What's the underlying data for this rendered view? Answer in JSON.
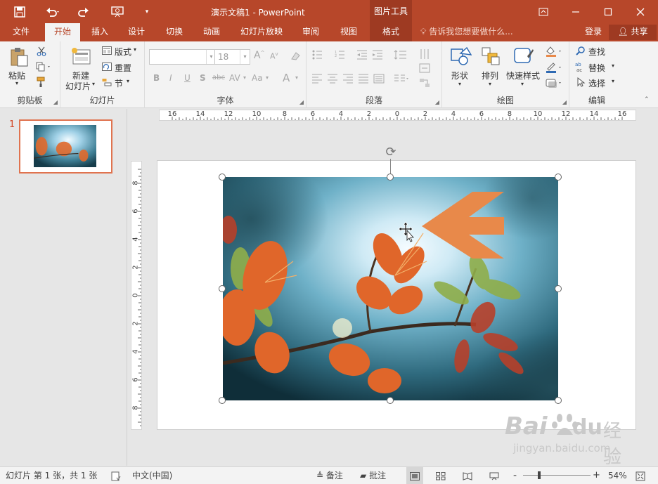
{
  "titlebar": {
    "title": "演示文稿1 - PowerPoint",
    "context_group": "图片工具",
    "qat": {
      "save_icon": "save-icon",
      "undo_icon": "undo-icon",
      "redo_icon": "redo-icon",
      "start_icon": "presentation-start-icon",
      "customize_icon": "customize-icon"
    }
  },
  "tabs": {
    "file": "文件",
    "home": "开始",
    "insert": "插入",
    "design": "设计",
    "transitions": "切换",
    "animations": "动画",
    "slideshow": "幻灯片放映",
    "review": "审阅",
    "view": "视图",
    "format": "格式"
  },
  "tell_me": "告诉我您想要做什么...",
  "login": "登录",
  "share": "共享",
  "ribbon": {
    "clipboard": {
      "label": "剪贴板",
      "paste": "粘贴"
    },
    "slides": {
      "label": "幻灯片",
      "new_slide_line1": "新建",
      "new_slide_line2": "幻灯片",
      "layout": "版式",
      "reset": "重置",
      "section": "节"
    },
    "font": {
      "label": "字体",
      "font_name": "",
      "font_size": "18",
      "bold": "B",
      "italic": "I",
      "underline": "U",
      "shadow": "S",
      "strike": "abc",
      "spacing": "AV",
      "case": "Aa",
      "color": "A",
      "grow": "A",
      "shrink": "A"
    },
    "paragraph": {
      "label": "段落"
    },
    "drawing": {
      "label": "绘图",
      "shapes": "形状",
      "arrange": "排列",
      "quick_styles": "快速样式"
    },
    "editing": {
      "label": "编辑",
      "find": "查找",
      "replace": "替换",
      "select": "选择"
    }
  },
  "thumbnail": {
    "slide_number": "1"
  },
  "hruler_labels": [
    "16",
    "14",
    "12",
    "10",
    "8",
    "6",
    "4",
    "2",
    "0",
    "2",
    "4",
    "6",
    "8",
    "10",
    "12",
    "14",
    "16"
  ],
  "vruler_labels": [
    "8",
    "6",
    "4",
    "2",
    "0",
    "2",
    "4",
    "6",
    "8"
  ],
  "statusbar": {
    "slide_info": "幻灯片 第 1 张，共 1 张",
    "language": "中文(中国)",
    "notes": "备注",
    "comments": "批注",
    "zoom": "54%",
    "zoom_minus": "-",
    "zoom_plus": "+"
  },
  "watermark": {
    "brand": "Bai",
    "brand_tail": "du",
    "cn": "经验",
    "url": "jingyan.baidu.com"
  },
  "colors": {
    "accent": "#b7472a",
    "arrow": "#e8894a"
  }
}
